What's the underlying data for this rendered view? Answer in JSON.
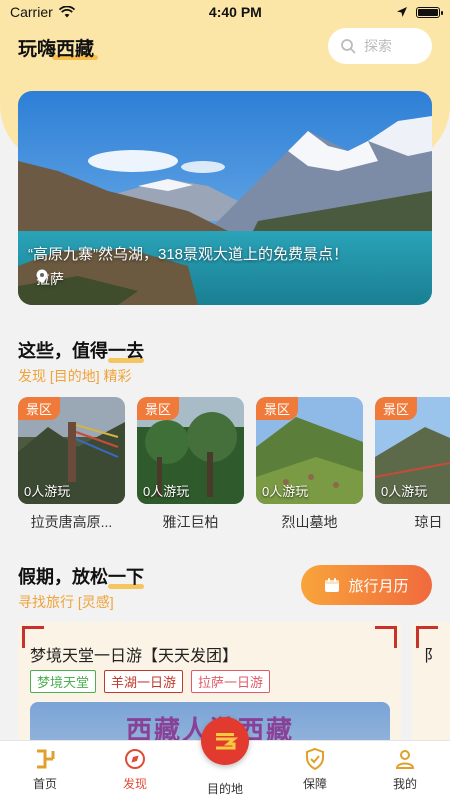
{
  "status_bar": {
    "carrier": "Carrier",
    "time": "4:40 PM"
  },
  "header": {
    "title": "玩嗨西藏",
    "search_placeholder": "探索"
  },
  "hero": {
    "caption": "“高原九寨”然乌湖，318景观大道上的免费景点！",
    "location": "拉萨"
  },
  "section1": {
    "title_prefix": "这些，值得",
    "title_highlight": "一去",
    "subtitle": "发现 [目的地] 精彩",
    "cards": [
      {
        "tag": "景区",
        "count": "0人游玩",
        "name": "拉贡唐高原..."
      },
      {
        "tag": "景区",
        "count": "0人游玩",
        "name": "雅江巨柏"
      },
      {
        "tag": "景区",
        "count": "0人游玩",
        "name": "烈山墓地"
      },
      {
        "tag": "景区",
        "count": "0人游玩",
        "name": "琼日"
      }
    ]
  },
  "section2": {
    "title_prefix": "假期，放松",
    "title_highlight": "一下",
    "subtitle": "寻找旅行 [灵感]",
    "calendar_button": "旅行月历"
  },
  "trip": {
    "title": "梦境天堂一日游【天天发团】",
    "tags": [
      {
        "label": "梦境天堂",
        "color": "#4caf50"
      },
      {
        "label": "羊湖一日游",
        "color": "#c0392b"
      },
      {
        "label": "拉萨一日游",
        "color": "#e05a6a"
      }
    ],
    "banner_text": "西藏人游西藏",
    "next_card_initial": "阝"
  },
  "tabbar": {
    "items": [
      "首页",
      "发现",
      "目的地",
      "保障",
      "我的"
    ],
    "active": "发现",
    "accent": "#e04c35",
    "center_color": "#e23a2e"
  },
  "colors": {
    "brand_yellow": "#fbe6a8",
    "orange": "#f0a33a",
    "tag_orange": "#f07a3a"
  }
}
